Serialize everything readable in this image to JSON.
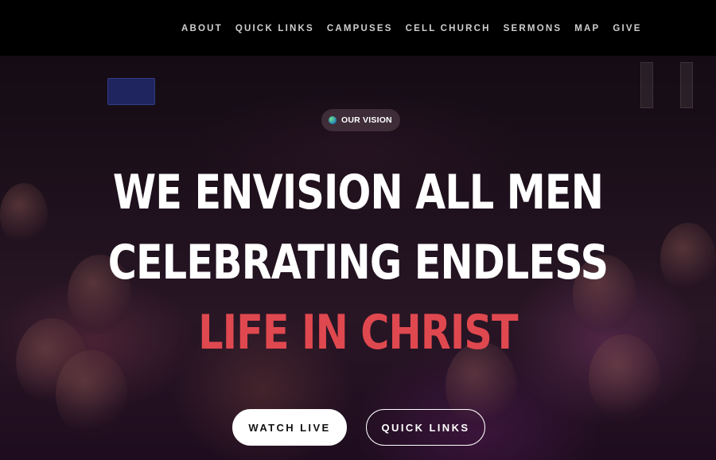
{
  "nav": {
    "items": [
      "ABOUT",
      "QUICK LINKS",
      "CAMPUSES",
      "CELL CHURCH",
      "SERMONS",
      "MAP",
      "GIVE"
    ]
  },
  "hero": {
    "badge": {
      "label": "OUR VISION",
      "icon": "globe-icon"
    },
    "headline": {
      "line1": "WE ENVISION ALL MEN",
      "line2": "CELEBRATING ENDLESS",
      "line3": "LIFE IN CHRIST"
    },
    "buttons": {
      "watch_live": "WATCH LIVE",
      "quick_links": "QUICK LINKS"
    }
  },
  "colors": {
    "accent": "#e0484f",
    "nav_bg": "#000000",
    "nav_text": "#cfcfcf"
  }
}
